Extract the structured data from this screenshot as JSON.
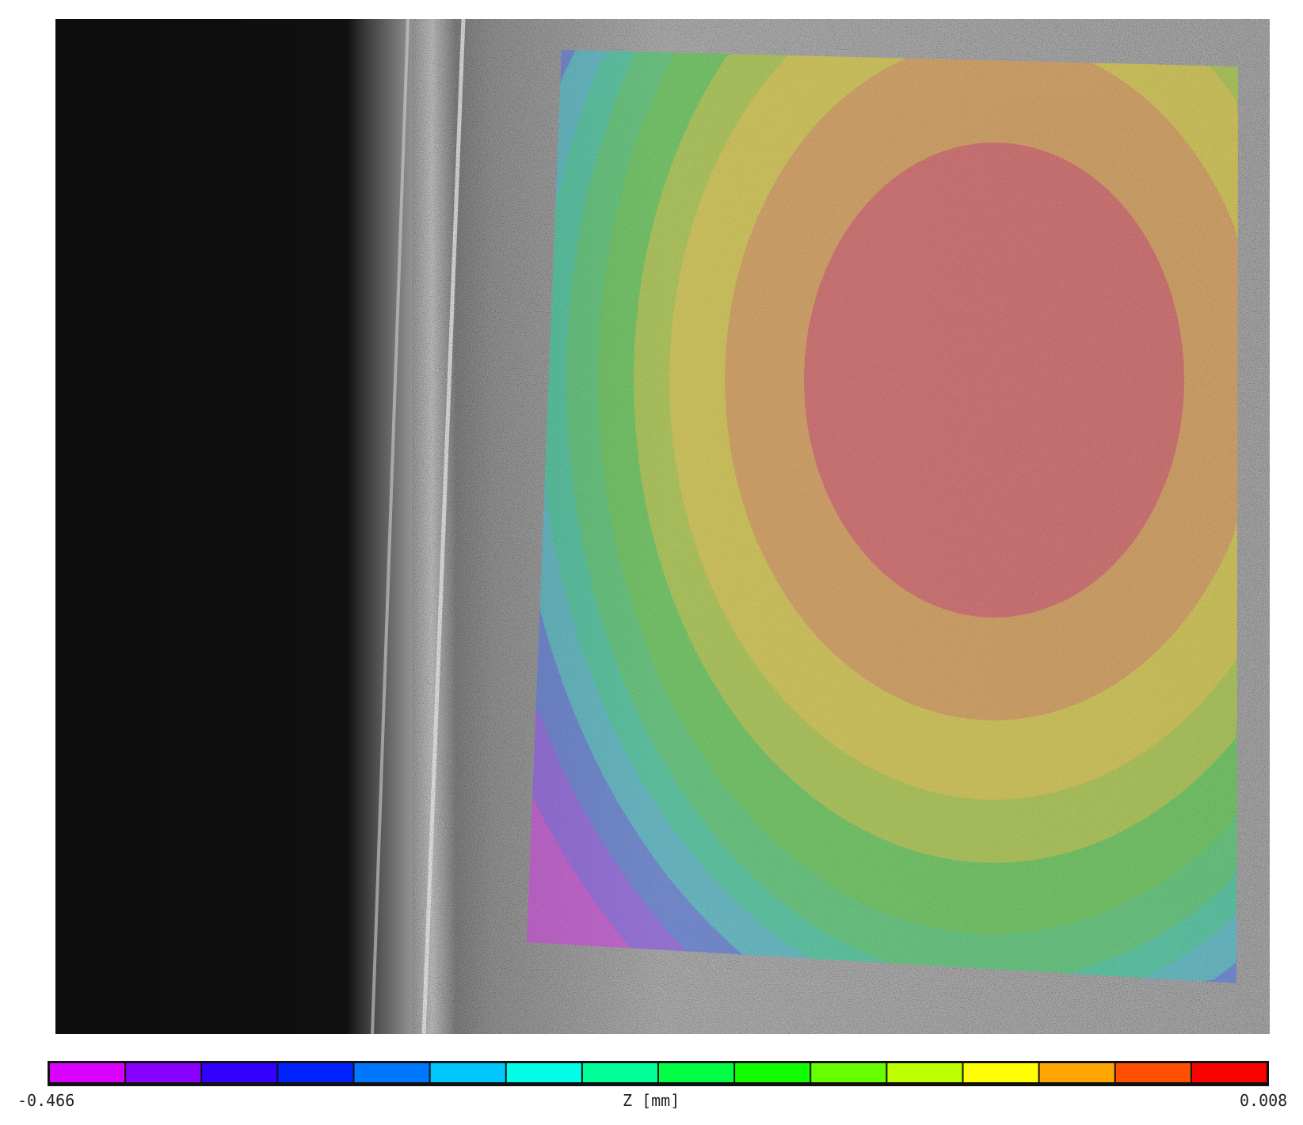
{
  "chart_data": {
    "type": "heatmap",
    "title": "",
    "description_kind": "contour overlay on camera image",
    "colorbar": {
      "label": "Z [mm]",
      "min": -0.466,
      "max": 0.008,
      "min_label": "-0.466",
      "max_label": "0.008",
      "levels": 16,
      "colors": [
        "#d800ff",
        "#8a00ff",
        "#3300ff",
        "#0022ff",
        "#0077ff",
        "#00c8ff",
        "#00ffe8",
        "#00ff99",
        "#00ff44",
        "#11ff00",
        "#66ff00",
        "#bbff00",
        "#ffff00",
        "#ffa500",
        "#ff5000",
        "#ff0000"
      ]
    },
    "field": {
      "peak_value": 0.008,
      "peak_location": "upper-center-right",
      "min_value": -0.466,
      "min_location": "lower-left edge"
    }
  }
}
